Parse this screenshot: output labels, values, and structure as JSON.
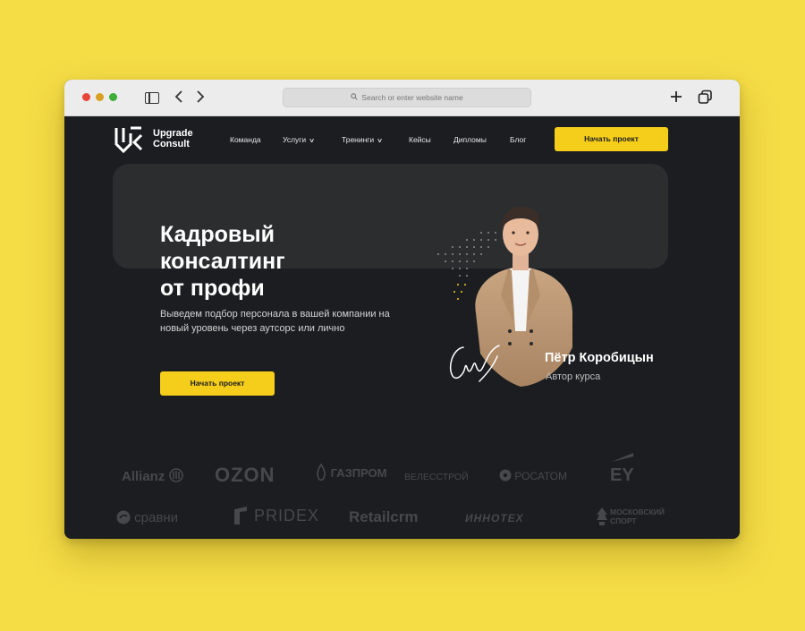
{
  "browser": {
    "address_placeholder": "Search or enter website name"
  },
  "header": {
    "logo_line1": "Upgrade",
    "logo_line2": "Consult",
    "nav": [
      "Команда",
      "Услуги",
      "Тренинги",
      "Кейсы",
      "Дипломы",
      "Блог"
    ],
    "cta_label": "Начать проект"
  },
  "hero": {
    "title_line1": "Кадровый",
    "title_line2": "консалтинг",
    "title_line3": "от профи",
    "subtitle": "Выведем подбор персонала в вашей компании на новый уровень через аутсорс или лично",
    "cta_label": "Начать проект",
    "person_name": "Пётр Коробицын",
    "person_role": "Автор курса"
  },
  "clients": {
    "row1": [
      "Allianz",
      "OZON",
      "ГАЗПРОМ",
      "ВЕЛЕССТРОЙ",
      "РОСАТОМ",
      "EY"
    ],
    "row2": [
      "сравни",
      "PRIDEX",
      "Retailcrm",
      "ИННОТЕХ",
      "МОСКОВСКИЙ",
      "СПОРТ"
    ]
  },
  "colors": {
    "accent": "#f5cd1b",
    "page_bg": "#1b1d20",
    "backdrop": "#f5dd46"
  }
}
